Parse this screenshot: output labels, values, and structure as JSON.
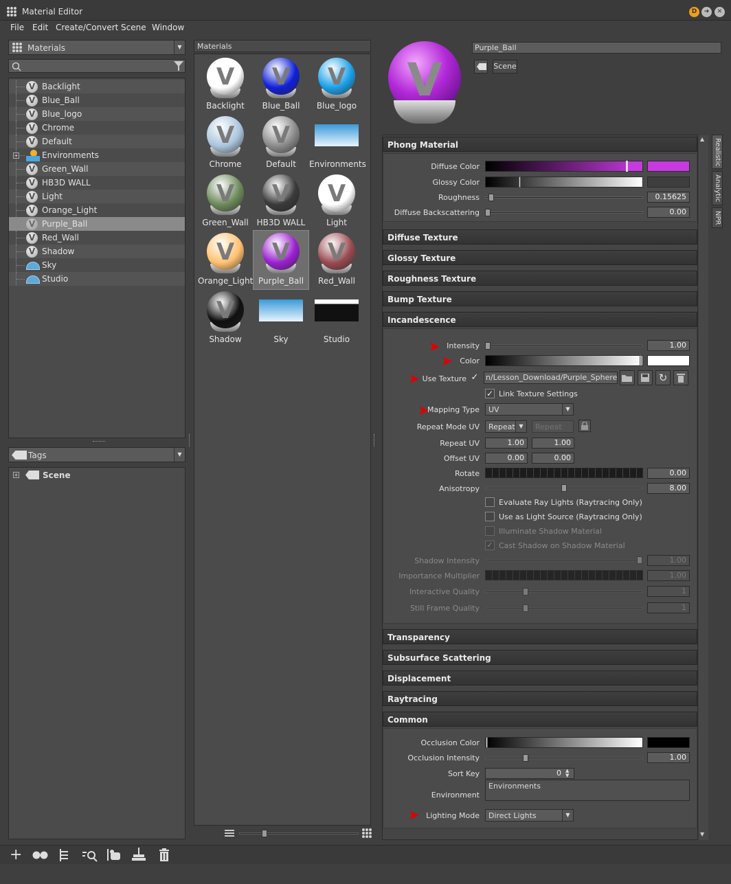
{
  "window": {
    "title": "Material Editor"
  },
  "menu": [
    "File",
    "Edit",
    "Create/Convert",
    "Scene",
    "Window"
  ],
  "left": {
    "combo_label": "Materials",
    "tree": [
      {
        "label": "Backlight",
        "icon": "v-ball-icon"
      },
      {
        "label": "Blue_Ball",
        "icon": "v-ball-icon"
      },
      {
        "label": "Blue_logo",
        "icon": "v-ball-icon"
      },
      {
        "label": "Chrome",
        "icon": "v-ball-icon"
      },
      {
        "label": "Default",
        "icon": "v-ball-icon"
      },
      {
        "label": "Environments",
        "icon": "environment-group-icon"
      },
      {
        "label": "Green_Wall",
        "icon": "v-ball-icon"
      },
      {
        "label": "HB3D WALL",
        "icon": "v-ball-icon"
      },
      {
        "label": "Light",
        "icon": "v-ball-icon"
      },
      {
        "label": "Orange_Light",
        "icon": "v-ball-icon"
      },
      {
        "label": "Purple_Ball",
        "icon": "v-ball-icon",
        "selected": true
      },
      {
        "label": "Red_Wall",
        "icon": "v-ball-icon"
      },
      {
        "label": "Shadow",
        "icon": "v-ball-icon"
      },
      {
        "label": "Sky",
        "icon": "sky-icon"
      },
      {
        "label": "Studio",
        "icon": "sky-icon"
      }
    ],
    "tags_label": "Tags",
    "tags_tree": [
      {
        "label": "Scene"
      }
    ]
  },
  "middle": {
    "header": "Materials",
    "thumbs": [
      {
        "label": "Backlight",
        "color": "#ffffff"
      },
      {
        "label": "Blue_Ball",
        "color": "#1020d8"
      },
      {
        "label": "Blue_logo",
        "color": "#1aa0e8"
      },
      {
        "label": "Chrome",
        "color": "#aac4dc"
      },
      {
        "label": "Default",
        "color": "#8a8a8a"
      },
      {
        "label": "Environments",
        "color": "#6fb8ea"
      },
      {
        "label": "Green_Wall",
        "color": "#6c8a5a"
      },
      {
        "label": "HB3D WALL",
        "color": "#3a3a3a"
      },
      {
        "label": "Light",
        "color": "#ffffff"
      },
      {
        "label": "Orange_Light",
        "color": "#ffc070"
      },
      {
        "label": "Purple_Ball",
        "color": "#9a1fd0",
        "selected": true
      },
      {
        "label": "Red_Wall",
        "color": "#9a4a50"
      },
      {
        "label": "Shadow",
        "color": "#101010"
      },
      {
        "label": "Sky",
        "color": "#4aa6e0"
      },
      {
        "label": "Studio",
        "color": "#111111"
      }
    ]
  },
  "right": {
    "name_value": "Purple_Ball",
    "scene_tag": "Scene",
    "tabs": [
      "Realistic",
      "Analytic",
      "NPR"
    ],
    "phong": {
      "title": "Phong Material",
      "diffuse_label": "Diffuse Color",
      "diffuse_color": "#c63adf",
      "glossy_label": "Glossy Color",
      "roughness_label": "Roughness",
      "roughness_value": "0.15625",
      "diffuse_back_label": "Diffuse Backscattering",
      "diffuse_back_value": "0.00"
    },
    "sections1": [
      "Diffuse Texture",
      "Glossy Texture",
      "Roughness Texture",
      "Bump Texture"
    ],
    "incandescence": {
      "title": "Incandescence",
      "intensity_label": "Intensity",
      "intensity_value": "1.00",
      "color_label": "Color",
      "use_texture_label": "Use Texture",
      "texture_path": "n/Lesson_Download/Purple_Sphere.png",
      "link_label": "Link Texture Settings",
      "mapping_label": "Mapping Type",
      "mapping_value": "UV",
      "repeat_mode_label": "Repeat Mode UV",
      "repeat_mode_value": "Repeat",
      "repeat_mode_value2": "Repeat",
      "repeat_uv_label": "Repeat UV",
      "repeat_uv": [
        "1.00",
        "1.00"
      ],
      "offset_uv_label": "Offset UV",
      "offset_uv": [
        "0.00",
        "0.00"
      ],
      "rotate_label": "Rotate",
      "rotate_value": "0.00",
      "aniso_label": "Anisotropy",
      "aniso_value": "8.00",
      "eval_ray_label": "Evaluate Ray Lights (Raytracing Only)",
      "light_source_label": "Use as Light Source (Raytracing Only)",
      "illum_shadow_label": "Illuminate Shadow Material",
      "cast_shadow_label": "Cast Shadow on Shadow Material",
      "shadow_int_label": "Shadow Intensity",
      "shadow_int_value": "1.00",
      "importance_label": "Importance Multiplier",
      "importance_value": "1.00",
      "interactive_label": "Interactive Quality",
      "interactive_value": "1",
      "still_label": "Still Frame Quality",
      "still_value": "1"
    },
    "sections2": [
      "Transparency",
      "Subsurface Scattering",
      "Displacement",
      "Raytracing"
    ],
    "common": {
      "title": "Common",
      "occ_color_label": "Occlusion Color",
      "occ_int_label": "Occlusion Intensity",
      "occ_int_value": "1.00",
      "sort_key_label": "Sort Key",
      "sort_key_value": "0",
      "env_label": "Environment",
      "env_value": "Environments",
      "lighting_label": "Lighting Mode",
      "lighting_value": "Direct Lights"
    }
  },
  "toolbar_icons": [
    "add-icon",
    "duplicate-icon",
    "group-icon",
    "find-icon",
    "select-nodes-icon",
    "cleanup-icon",
    "delete-icon"
  ]
}
